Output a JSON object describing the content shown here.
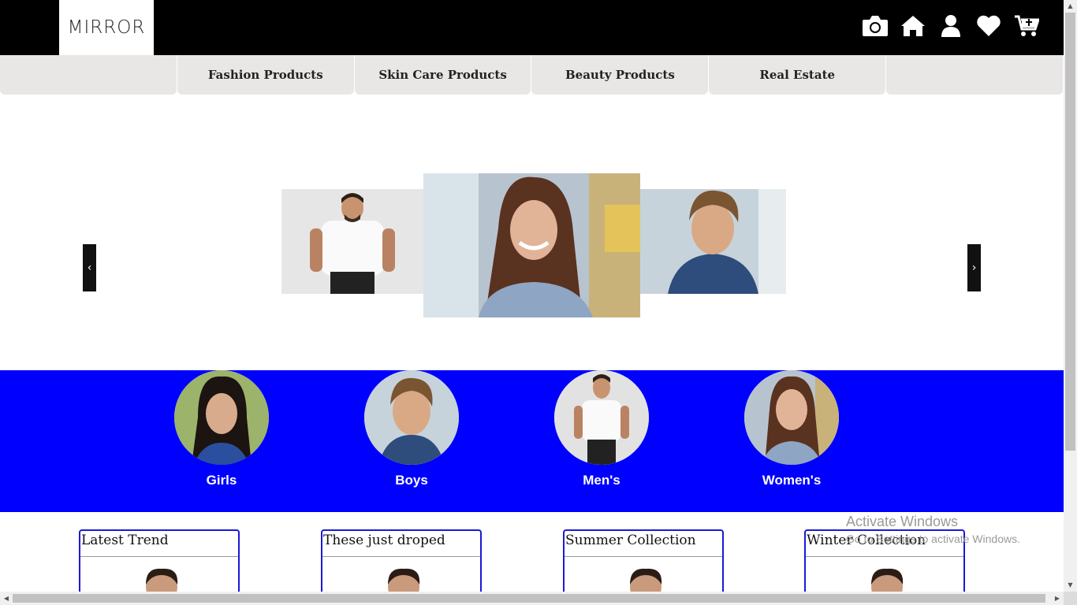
{
  "header": {
    "logo_text": "MIRROR",
    "icons": [
      "camera-icon",
      "home-icon",
      "user-icon",
      "heart-icon",
      "cart-icon"
    ]
  },
  "nav": {
    "tabs": [
      {
        "label": ""
      },
      {
        "label": "Fashion Products"
      },
      {
        "label": "Skin Care Products"
      },
      {
        "label": "Beauty Products"
      },
      {
        "label": "Real Estate"
      },
      {
        "label": ""
      }
    ]
  },
  "carousel": {
    "prev_label": "‹",
    "next_label": "›"
  },
  "categories": {
    "background": "#0000ff",
    "items": [
      {
        "label": "Girls"
      },
      {
        "label": "Boys"
      },
      {
        "label": "Men's"
      },
      {
        "label": "Women's"
      }
    ]
  },
  "collections": [
    {
      "title": "Latest Trend"
    },
    {
      "title": "These just droped"
    },
    {
      "title": "Summer Collection"
    },
    {
      "title": "Winter Collection"
    }
  ],
  "watermark": {
    "line1": "Activate Windows",
    "line2": "Go to Settings to activate Windows."
  }
}
